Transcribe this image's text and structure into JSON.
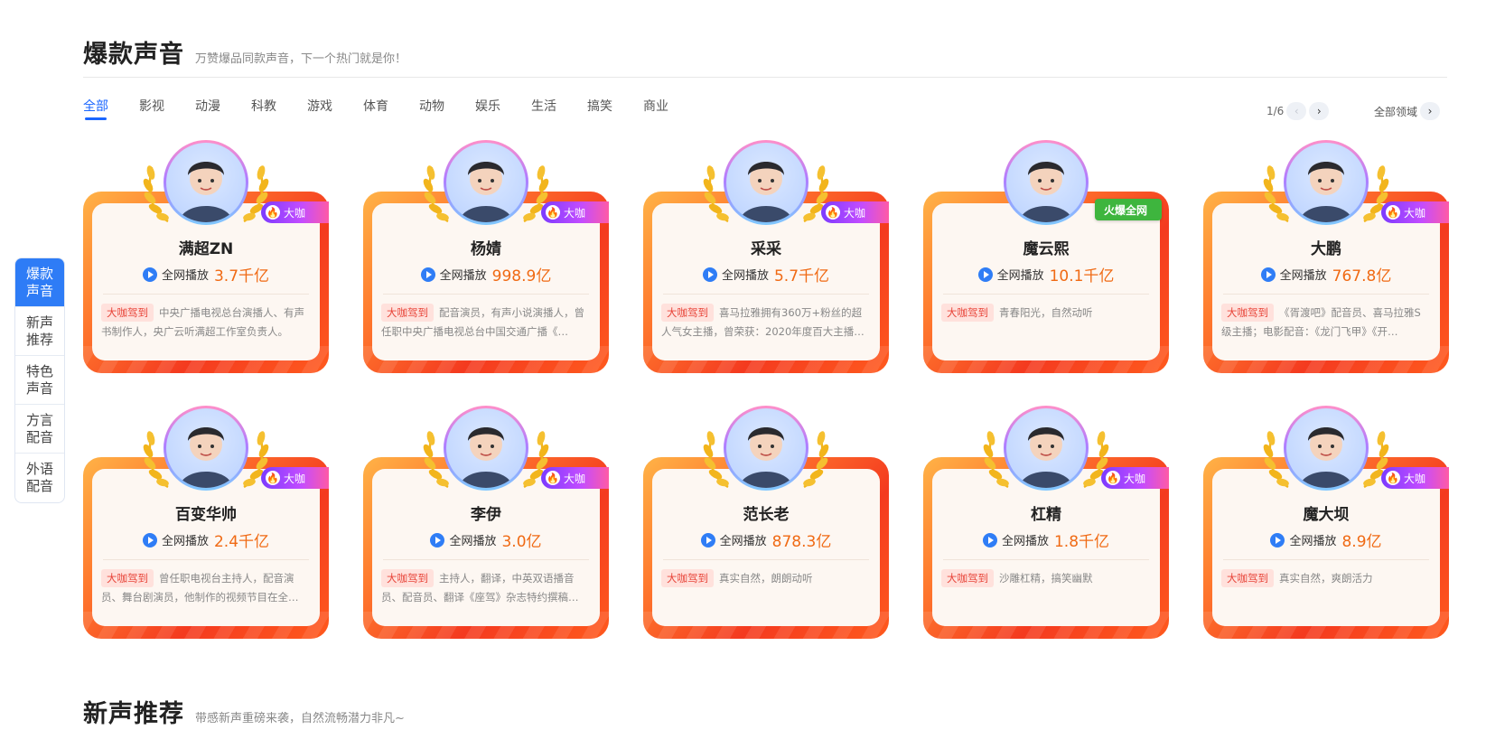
{
  "section1": {
    "title": "爆款声音",
    "subtitle": "万赞爆品同款声音，下一个热门就是你！"
  },
  "section2": {
    "title": "新声推荐",
    "subtitle": "带感新声重磅来袭，自然流畅潜力非凡~"
  },
  "tabs": [
    "全部",
    "影视",
    "动漫",
    "科教",
    "游戏",
    "体育",
    "动物",
    "娱乐",
    "生活",
    "搞笑",
    "商业"
  ],
  "pager": {
    "text": "1/6",
    "prev_icon": "‹",
    "next_icon": "›"
  },
  "all_fields": {
    "label": "全部领域",
    "icon": "›"
  },
  "sidenav": [
    "爆款声音",
    "新声推荐",
    "特色声音",
    "方言配音",
    "外语配音"
  ],
  "play_label": "全网播放",
  "tag_label": "大咖驾到",
  "badge_label": "大咖",
  "hot_badge_label": "火爆全网",
  "cards": [
    {
      "name": "满超ZN",
      "plays": "3.7千亿",
      "badge": "vip",
      "desc": "中央广播电视总台演播人、有声书制作人，央广云听满超工作室负责人。"
    },
    {
      "name": "杨婧",
      "plays": "998.9亿",
      "badge": "vip",
      "desc": "配音演员，有声小说演播人，曾任职中央广播电视总台中国交通广播《…"
    },
    {
      "name": "采采",
      "plays": "5.7千亿",
      "badge": "vip",
      "desc": "喜马拉雅拥有360万+粉丝的超人气女主播，曾荣获：2020年度百大主播…"
    },
    {
      "name": "魔云熙",
      "plays": "10.1千亿",
      "badge": "hot",
      "desc": "青春阳光，自然动听"
    },
    {
      "name": "大鹏",
      "plays": "767.8亿",
      "badge": "vip",
      "desc": "《胥渡吧》配音员、喜马拉雅S级主播；电影配音：《龙门飞甲》《开…"
    },
    {
      "name": "百变华帅",
      "plays": "2.4千亿",
      "badge": "vip",
      "desc": "曾任职电视台主持人，配音演员、舞台剧演员，他制作的视频节目在全…"
    },
    {
      "name": "李伊",
      "plays": "3.0亿",
      "badge": "vip",
      "desc": "主持人，翻译，中英双语播音员、配音员、翻译《座驾》杂志特约撰稿…"
    },
    {
      "name": "范长老",
      "plays": "878.3亿",
      "badge": "none",
      "desc": "真实自然，朗朗动听"
    },
    {
      "name": "杠精",
      "plays": "1.8千亿",
      "badge": "vip",
      "desc": "沙雕杠精，搞笑幽默"
    },
    {
      "name": "魔大坝",
      "plays": "8.9亿",
      "badge": "vip",
      "desc": "真实自然，爽朗活力"
    }
  ],
  "colors": {
    "accent": "#1a66ff",
    "play_count": "#f06a14",
    "tag_text": "#e8453a",
    "tag_bg": "#ffe1dc",
    "frame_red": "#f43a1f",
    "frame_orange": "#ffb347",
    "hot_green": "#3eb53e"
  }
}
